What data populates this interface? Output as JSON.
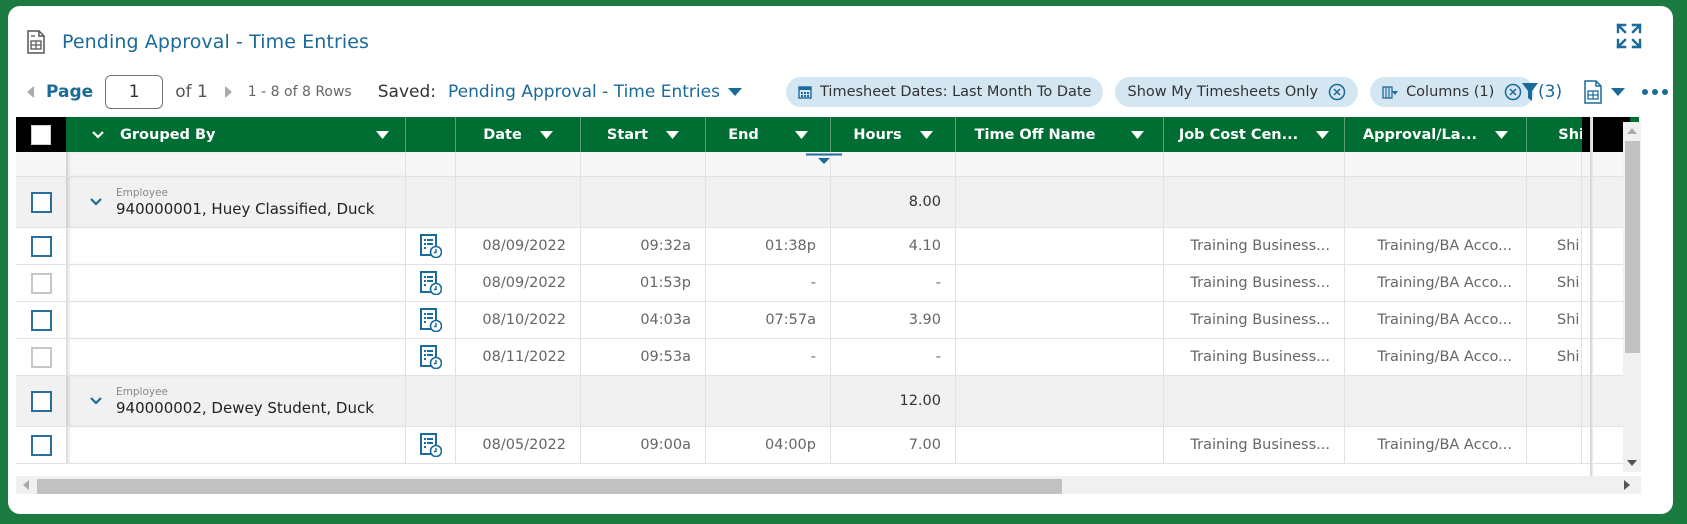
{
  "header": {
    "title": "Pending Approval - Time Entries",
    "title_icon": "report-icon",
    "expand_icon": "expand-icon"
  },
  "toolbar": {
    "page_label": "Page",
    "page_value": "1",
    "of_label": "of 1",
    "rows_label": "1 - 8 of 8 Rows",
    "saved_label": "Saved:",
    "saved_value": "Pending Approval - Time Entries",
    "chips": [
      {
        "label": "Timesheet Dates: Last Month To Date",
        "icon": "calendar-icon",
        "removable": false
      },
      {
        "label": "Show My Timesheets Only",
        "icon": null,
        "removable": true
      },
      {
        "label": "Columns (1)",
        "icon": "columns-icon",
        "removable": true
      }
    ],
    "filter_count": "(3)",
    "export_icon": "export-icon",
    "more_icon": "more-icon"
  },
  "colors": {
    "brand_green": "#006e33",
    "link_blue": "#1a6a9a",
    "chip_bg": "#d4e6f1",
    "frame_green": "#1a7a40"
  },
  "grid": {
    "columns": [
      {
        "label": ""
      },
      {
        "label": "Grouped By"
      },
      {
        "label": ""
      },
      {
        "label": "Date"
      },
      {
        "label": "Start"
      },
      {
        "label": "End"
      },
      {
        "label": "Hours"
      },
      {
        "label": "Time Off Name"
      },
      {
        "label": "Job Cost Cen..."
      },
      {
        "label": "Approval/La..."
      },
      {
        "label": "Shi"
      }
    ],
    "groups": [
      {
        "caption": "Employee",
        "name": "940000001, Huey Classified, Duck",
        "hours": "8.00",
        "rows": [
          {
            "date": "08/09/2022",
            "start": "09:32a",
            "end": "01:38p",
            "hours": "4.10",
            "time_off": "",
            "job_cost": "Training Business...",
            "approval": "Training/BA Acco...",
            "shift": "Shi",
            "selectable": true
          },
          {
            "date": "08/09/2022",
            "start": "01:53p",
            "end": "-",
            "hours": "-",
            "time_off": "",
            "job_cost": "Training Business...",
            "approval": "Training/BA Acco...",
            "shift": "Shi",
            "selectable": false
          },
          {
            "date": "08/10/2022",
            "start": "04:03a",
            "end": "07:57a",
            "hours": "3.90",
            "time_off": "",
            "job_cost": "Training Business...",
            "approval": "Training/BA Acco...",
            "shift": "Shi",
            "selectable": true
          },
          {
            "date": "08/11/2022",
            "start": "09:53a",
            "end": "-",
            "hours": "-",
            "time_off": "",
            "job_cost": "Training Business...",
            "approval": "Training/BA Acco...",
            "shift": "Shi",
            "selectable": false
          }
        ]
      },
      {
        "caption": "Employee",
        "name": "940000002, Dewey Student, Duck",
        "hours": "12.00",
        "rows": [
          {
            "date": "08/05/2022",
            "start": "09:00a",
            "end": "04:00p",
            "hours": "7.00",
            "time_off": "",
            "job_cost": "Training Business...",
            "approval": "Training/BA Acco...",
            "shift": "",
            "selectable": true
          }
        ]
      }
    ]
  }
}
